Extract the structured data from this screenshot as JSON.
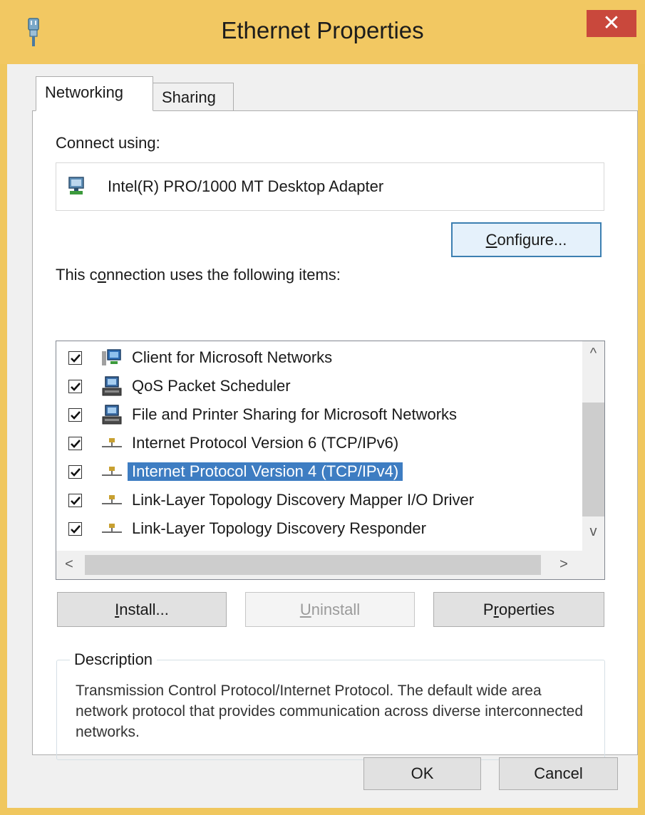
{
  "window": {
    "title": "Ethernet Properties",
    "close_glyph": "✕"
  },
  "tabs": [
    {
      "label": "Networking",
      "active": true
    },
    {
      "label": "Sharing",
      "active": false
    }
  ],
  "connect_using": {
    "label": "Connect using:",
    "adapter": "Intel(R) PRO/1000 MT Desktop Adapter",
    "adapter_icon": "network-adapter-icon"
  },
  "configure_button": {
    "pre": "",
    "key": "C",
    "post": "onfigure..."
  },
  "items_label": {
    "pre": "This c",
    "key": "o",
    "post": "nnection uses the following items:"
  },
  "items": [
    {
      "label": "Client for Microsoft Networks",
      "checked": true,
      "icon": "network-client-icon"
    },
    {
      "label": "QoS Packet Scheduler",
      "checked": true,
      "icon": "service-icon"
    },
    {
      "label": "File and Printer Sharing for Microsoft Networks",
      "checked": true,
      "icon": "service-icon"
    },
    {
      "label": "Internet Protocol Version 6 (TCP/IPv6)",
      "checked": true,
      "icon": "protocol-icon"
    },
    {
      "label": "Internet Protocol Version 4 (TCP/IPv4)",
      "checked": true,
      "icon": "protocol-icon",
      "selected": true
    },
    {
      "label": "Link-Layer Topology Discovery Mapper I/O Driver",
      "checked": true,
      "icon": "protocol-icon"
    },
    {
      "label": "Link-Layer Topology Discovery Responder",
      "checked": true,
      "icon": "protocol-icon"
    }
  ],
  "scroll_glyphs": {
    "up": "^",
    "down": "v",
    "left": "<",
    "right": ">"
  },
  "action_buttons": {
    "install": {
      "pre": "",
      "key": "I",
      "post": "nstall..."
    },
    "uninstall": {
      "pre": "",
      "key": "U",
      "post": "ninstall"
    },
    "properties": {
      "pre": "P",
      "key": "r",
      "post": "operties"
    }
  },
  "description": {
    "legend": "Description",
    "text": "Transmission Control Protocol/Internet Protocol. The default wide area network protocol that provides communication across diverse interconnected networks."
  },
  "footer": {
    "ok": "OK",
    "cancel": "Cancel"
  },
  "colors": {
    "titlebar": "#f2c862",
    "close": "#c9483c",
    "selection": "#3e7dc2"
  }
}
